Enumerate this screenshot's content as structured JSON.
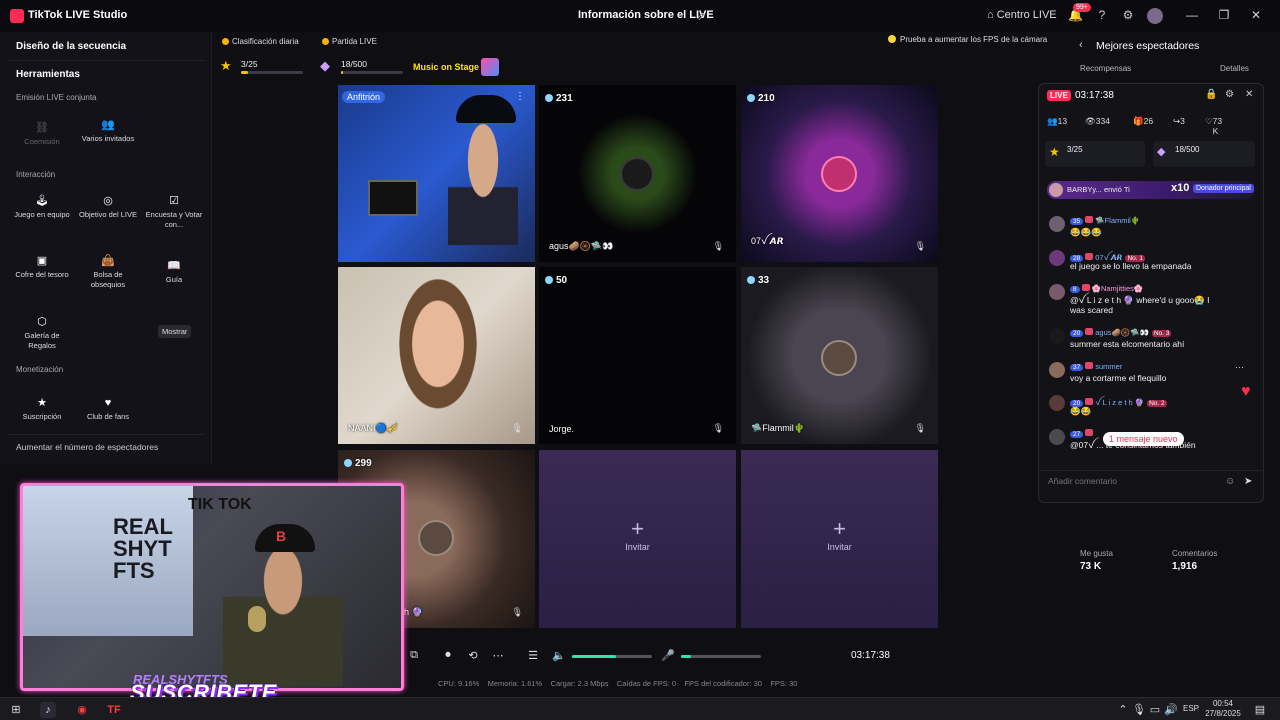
{
  "app": {
    "title": "TikTok LIVE Studio",
    "center_title": "Información sobre el LIVE",
    "centro_label": "Centro LIVE",
    "notif_count": "99+"
  },
  "left_panel": {
    "section_title": "Diseño de la secuencia",
    "tools_title": "Herramientas",
    "group_joint": "Emisión LIVE conjunta",
    "group_interaction": "Interacción",
    "group_monetization": "Monetización",
    "tiles": {
      "coemision": "Coemisión",
      "varios": "Varios invitados",
      "juego": "Juego en equipo",
      "objetivo": "Objetivo del LIVE",
      "encuesta": "Encuesta y Votar con...",
      "cofre": "Cofre del tesoro",
      "bolsa": "Bolsa de obsequios",
      "guia": "Guía",
      "galeria": "Galería de Regalos",
      "suscripcion": "Suscripción",
      "club": "Club de fans"
    },
    "tooltip": "Mostrar",
    "boost": "Aumentar el número de espectadores"
  },
  "top_bar": {
    "ranking": "Clasificación diaria",
    "match": "Partida LIVE",
    "goal1": "3/25",
    "goal1_progress": 0.12,
    "goal2": "18/500",
    "goal2_progress": 0.036,
    "music": "Music on Stage",
    "fps_hint": "Prueba a aumentar los FPS de la cámara"
  },
  "grid": {
    "host_tag": "Anfitrión",
    "cells": [
      {
        "viewers": "",
        "name": ""
      },
      {
        "viewers": "231",
        "name": "agus🥔🛞🛸👀"
      },
      {
        "viewers": "210",
        "name": "07ꪜ 𝘼𝙍"
      },
      {
        "viewers": "",
        "name": "NAANI🔵🎺"
      },
      {
        "viewers": "50",
        "name": "Jorge."
      },
      {
        "viewers": "33",
        "name": "🛸Flammil🌵"
      },
      {
        "viewers": "299",
        "name": "h 🔮"
      }
    ],
    "invite_label": "Invitar"
  },
  "controls": {
    "timer": "03:17:38",
    "volume": 0.55,
    "mic": 0.12
  },
  "stats": {
    "cpu": "CPU: 9.16%",
    "mem": "Memoria: 1.61%",
    "load": "Cargar: 2.3 Mbps",
    "drops": "Caídas de FPS: 0",
    "enc_fps": "FPS del codificador: 30",
    "fps": "FPS: 30"
  },
  "right_panel": {
    "title": "Mejores espectadores",
    "rewards": "Recompensas",
    "details": "Detalles",
    "likes_label": "Me gusta",
    "likes_value": "73 K",
    "comments_label": "Comentarios",
    "comments_value": "1,916"
  },
  "chat": {
    "live_badge": "LIVE",
    "timer": "03:17:38",
    "stat_viewers": "13",
    "stat_views": "334",
    "stat_gifts": "26",
    "stat_shares": "3",
    "stat_likes": "73 K",
    "goal1": "3/25",
    "goal2": "18/500",
    "gift_banner_text": "BARBYy... envió Ti",
    "gift_count": "x10",
    "gift_tag": "Donador principal",
    "messages": [
      {
        "lvl": "35",
        "user": "🛸Flammil🌵",
        "no": "",
        "text": "😂😂😂"
      },
      {
        "lvl": "28",
        "user": "07ꪜ 𝘼𝙍",
        "no": "No. 1",
        "text": "el juego se lo llevo la empanada"
      },
      {
        "lvl": "8",
        "user": "🌸Namjitties🌸",
        "no": "",
        "text": "@ꪜ L i z e t h 🔮 where'd u gooo😭 I was scared"
      },
      {
        "lvl": "20",
        "user": "agus🥔🛞🛸👀",
        "no": "No. 3",
        "text": "summer esta elcomentario ahí"
      },
      {
        "lvl": "37",
        "user": "summer",
        "no": "",
        "text": "voy a cortarme el flequillo"
      },
      {
        "lvl": "20",
        "user": "ꪜ L i z e t h 🔮",
        "no": "No. 2",
        "text": "😂😂"
      },
      {
        "lvl": "27",
        "user": "",
        "no": "",
        "text": "@07ꪜ ... te consintamos también"
      }
    ],
    "new_messages": "1 mensaje nuevo",
    "comment_placeholder": "Añadir comentario"
  },
  "webcam": {
    "graffiti_1": "REAL SHYT FTS",
    "graffiti_2": "TIK TOK",
    "cap_logo": "B",
    "brand": "REALSHYTFTS",
    "cta": "SUSCRIBETE"
  },
  "taskbar": {
    "lang": "ESP",
    "time": "00:54",
    "date": "27/8/2025"
  }
}
